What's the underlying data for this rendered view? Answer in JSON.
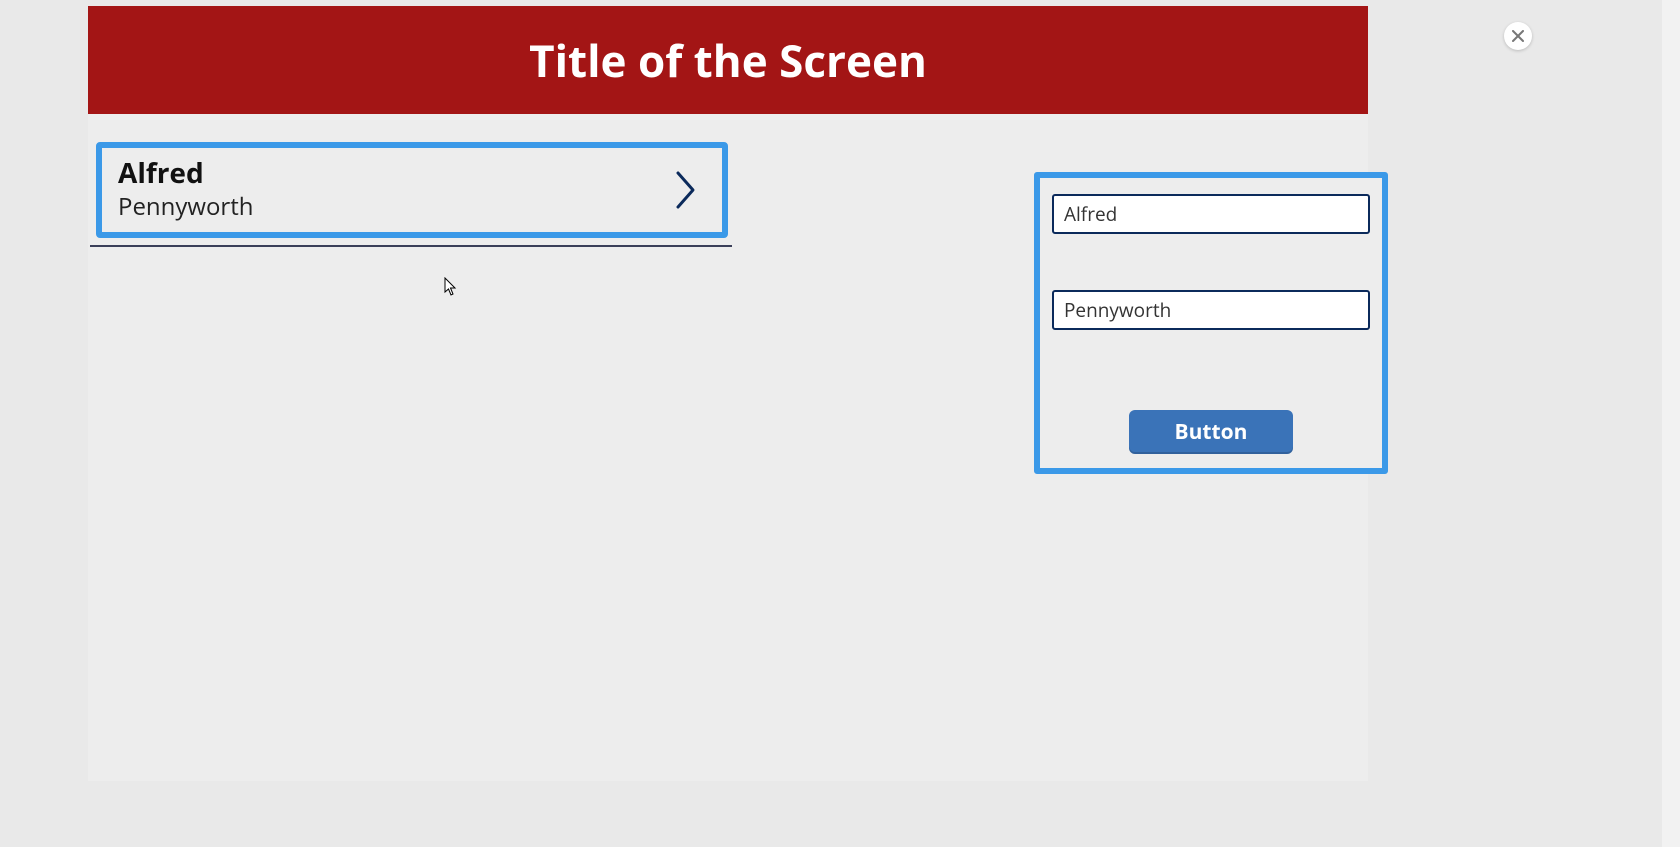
{
  "header": {
    "title": "Title of the Screen"
  },
  "list": {
    "item": {
      "primary": "Alfred",
      "secondary": "Pennyworth"
    }
  },
  "form": {
    "first_name_value": "Alfred",
    "last_name_value": "Pennyworth",
    "button_label": "Button"
  }
}
